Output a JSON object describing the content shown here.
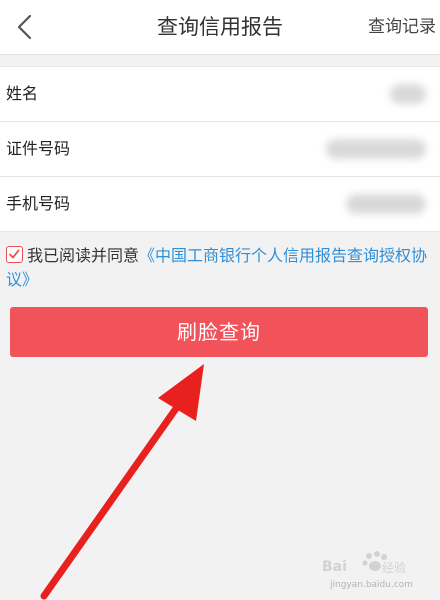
{
  "nav": {
    "title": "查询信用报告",
    "right_action": "查询记录",
    "back_icon": "chevron-left-icon"
  },
  "form": {
    "rows": [
      {
        "label": "姓名",
        "value_state": "obscured"
      },
      {
        "label": "证件号码",
        "value_state": "obscured"
      },
      {
        "label": "手机号码",
        "value_state": "obscured"
      }
    ]
  },
  "agreement": {
    "checked": true,
    "prefix": "我已阅读并同意",
    "link": "《中国工商银行个人信用报告查询授权协议》"
  },
  "submit_button": "刷脸查询",
  "colors": {
    "accent_red": "#f2525a",
    "link_blue": "#2f8fd8",
    "annotation_arrow": "#e8211f"
  },
  "watermark": {
    "logo_text": "Baidu经验",
    "url": "jingyan.baidu.com"
  }
}
